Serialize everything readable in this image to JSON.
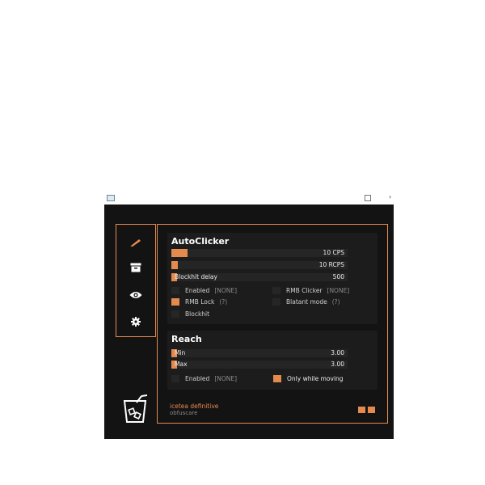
{
  "colors": {
    "accent": "#e58a4e",
    "background": "#131313",
    "panel": "#1c1c1c"
  },
  "sidebar": {
    "items": [
      {
        "icon": "pencil-icon",
        "active": true
      },
      {
        "icon": "archive-box-icon",
        "active": false
      },
      {
        "icon": "eye-icon",
        "active": false
      },
      {
        "icon": "gear-icon",
        "active": false
      }
    ]
  },
  "autoclicker": {
    "title": "AutoClicker",
    "left_cps": {
      "value": "10 CPS",
      "fill": 0.09
    },
    "right_cps": {
      "value": "10 RCPS",
      "fill": 0.035
    },
    "blockhit_delay": {
      "label": "Blockhit delay",
      "value": "500",
      "fill": 0.03
    },
    "enabled": {
      "label": "Enabled",
      "tag": "[NONE]",
      "checked": false
    },
    "rmb_clicker": {
      "label": "RMB Clicker",
      "tag": "[NONE]",
      "checked": false
    },
    "rmb_lock": {
      "label": "RMB Lock",
      "tag": "(?)",
      "checked": true
    },
    "blatant_mode": {
      "label": "Blatant mode",
      "tag": "(?)",
      "checked": false
    },
    "blockhit": {
      "label": "Blockhit",
      "checked": false
    }
  },
  "reach": {
    "title": "Reach",
    "min": {
      "label": "Min",
      "value": "3.00",
      "fill": 0.03
    },
    "max": {
      "label": "Max",
      "value": "3.00",
      "fill": 0.03
    },
    "enabled": {
      "label": "Enabled",
      "tag": "[NONE]",
      "checked": false
    },
    "only_while_moving": {
      "label": "Only while moving",
      "checked": true
    }
  },
  "footer": {
    "brand_name": "icetea definitive",
    "brand_sub": "obfuscare",
    "logo_icon": "iced-drink-icon"
  }
}
